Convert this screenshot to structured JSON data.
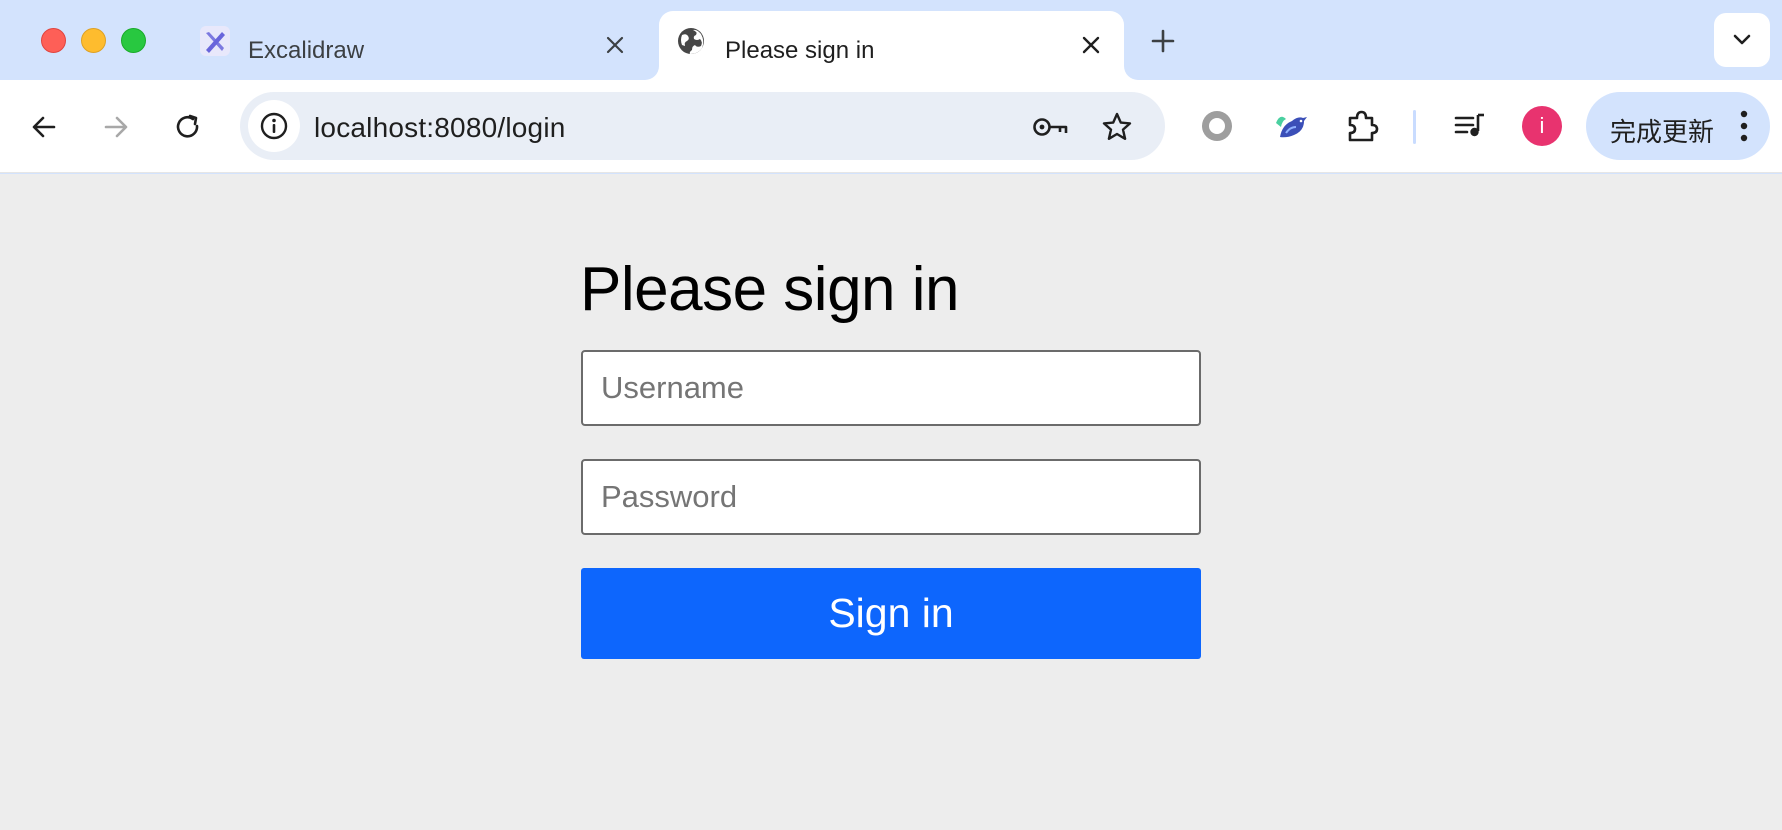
{
  "browser": {
    "tabs": [
      {
        "title": "Excalidraw",
        "favicon": "excalidraw-icon",
        "active": false
      },
      {
        "title": "Please sign in",
        "favicon": "globe-icon",
        "active": true
      }
    ],
    "address_bar": {
      "url": "localhost:8080/login"
    },
    "update_button": {
      "label": "完成更新"
    },
    "avatar": {
      "letter": "i",
      "color": "#e8336f"
    },
    "accent_color": "#d3e3fd"
  },
  "page": {
    "heading": "Please sign in",
    "username": {
      "placeholder": "Username",
      "value": ""
    },
    "password": {
      "placeholder": "Password",
      "value": ""
    },
    "submit_label": "Sign in",
    "submit_color": "#0d66fd",
    "background_color": "#ededed"
  }
}
